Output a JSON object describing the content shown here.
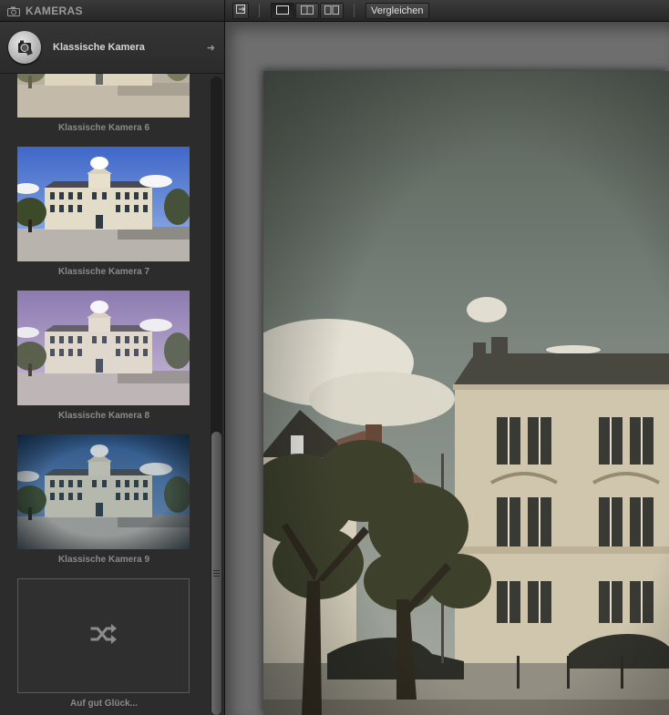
{
  "sidebar": {
    "title": "KAMERAS",
    "category": {
      "label": "Klassische Kamera"
    },
    "presets": [
      {
        "label": "Klassische Kamera 6"
      },
      {
        "label": "Klassische Kamera 7"
      },
      {
        "label": "Klassische Kamera 8"
      },
      {
        "label": "Klassische Kamera 9"
      }
    ],
    "random": {
      "label": "Auf gut Glück..."
    }
  },
  "toolbar": {
    "compare_label": "Vergleichen"
  },
  "icons": {
    "header": "camera-icon",
    "category": "classic-camera-logo-icon",
    "arrow": "arrow-right-icon",
    "random": "shuffle-icon",
    "export": "export-icon",
    "view_single": "single-view-icon",
    "view_split": "split-view-icon",
    "view_side": "side-by-side-view-icon"
  },
  "colors": {
    "panel": "#2c2c2c",
    "canvas": "#6e6e6e",
    "label": "#8a8a8a"
  }
}
